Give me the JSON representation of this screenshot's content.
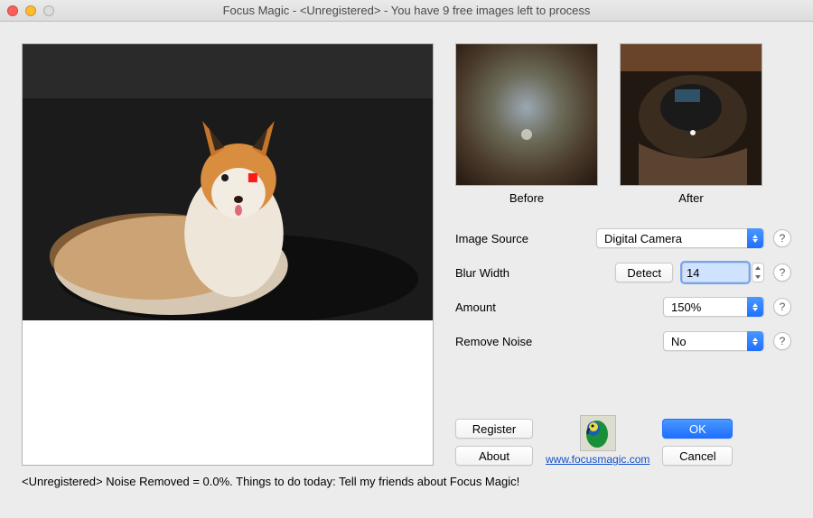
{
  "window": {
    "title": "Focus Magic - <Unregistered> - You have 9 free images left to process"
  },
  "thumbs": {
    "before_label": "Before",
    "after_label": "After"
  },
  "controls": {
    "image_source": {
      "label": "Image Source",
      "value": "Digital Camera"
    },
    "blur_width": {
      "label": "Blur Width",
      "detect": "Detect",
      "value": "14"
    },
    "amount": {
      "label": "Amount",
      "value": "150%"
    },
    "remove_noise": {
      "label": "Remove Noise",
      "value": "No"
    }
  },
  "buttons": {
    "register": "Register",
    "about": "About",
    "ok": "OK",
    "cancel": "Cancel"
  },
  "link": {
    "text": "www.focusmagic.com"
  },
  "status": "<Unregistered> Noise Removed = 0.0%. Things to do today: Tell my friends about Focus Magic!",
  "help": "?"
}
